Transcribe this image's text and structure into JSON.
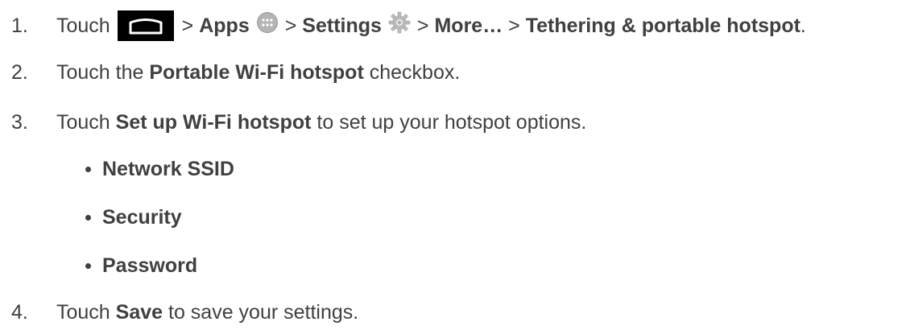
{
  "steps": {
    "s1": {
      "num": "1.",
      "touch": "Touch",
      "gt1": ">",
      "apps": "Apps",
      "gt2": ">",
      "settings": "Settings",
      "gt3": ">",
      "more": "More…",
      "gt4": ">",
      "tethering": "Tethering & portable hotspot",
      "end": "."
    },
    "s2": {
      "num": "2.",
      "pre": "Touch the ",
      "bold": "Portable Wi-Fi hotspot",
      "post": " checkbox."
    },
    "s3": {
      "num": "3.",
      "pre": "Touch ",
      "bold": "Set up Wi-Fi hotspot",
      "post": " to set up your hotspot options."
    },
    "s4": {
      "num": "4.",
      "pre": "Touch ",
      "bold": "Save",
      "post": " to save your settings."
    }
  },
  "options": [
    "Network SSID",
    "Security",
    "Password"
  ],
  "icons": {
    "home": "home-button-icon",
    "apps": "apps-icon",
    "settings": "settings-gear-icon"
  }
}
